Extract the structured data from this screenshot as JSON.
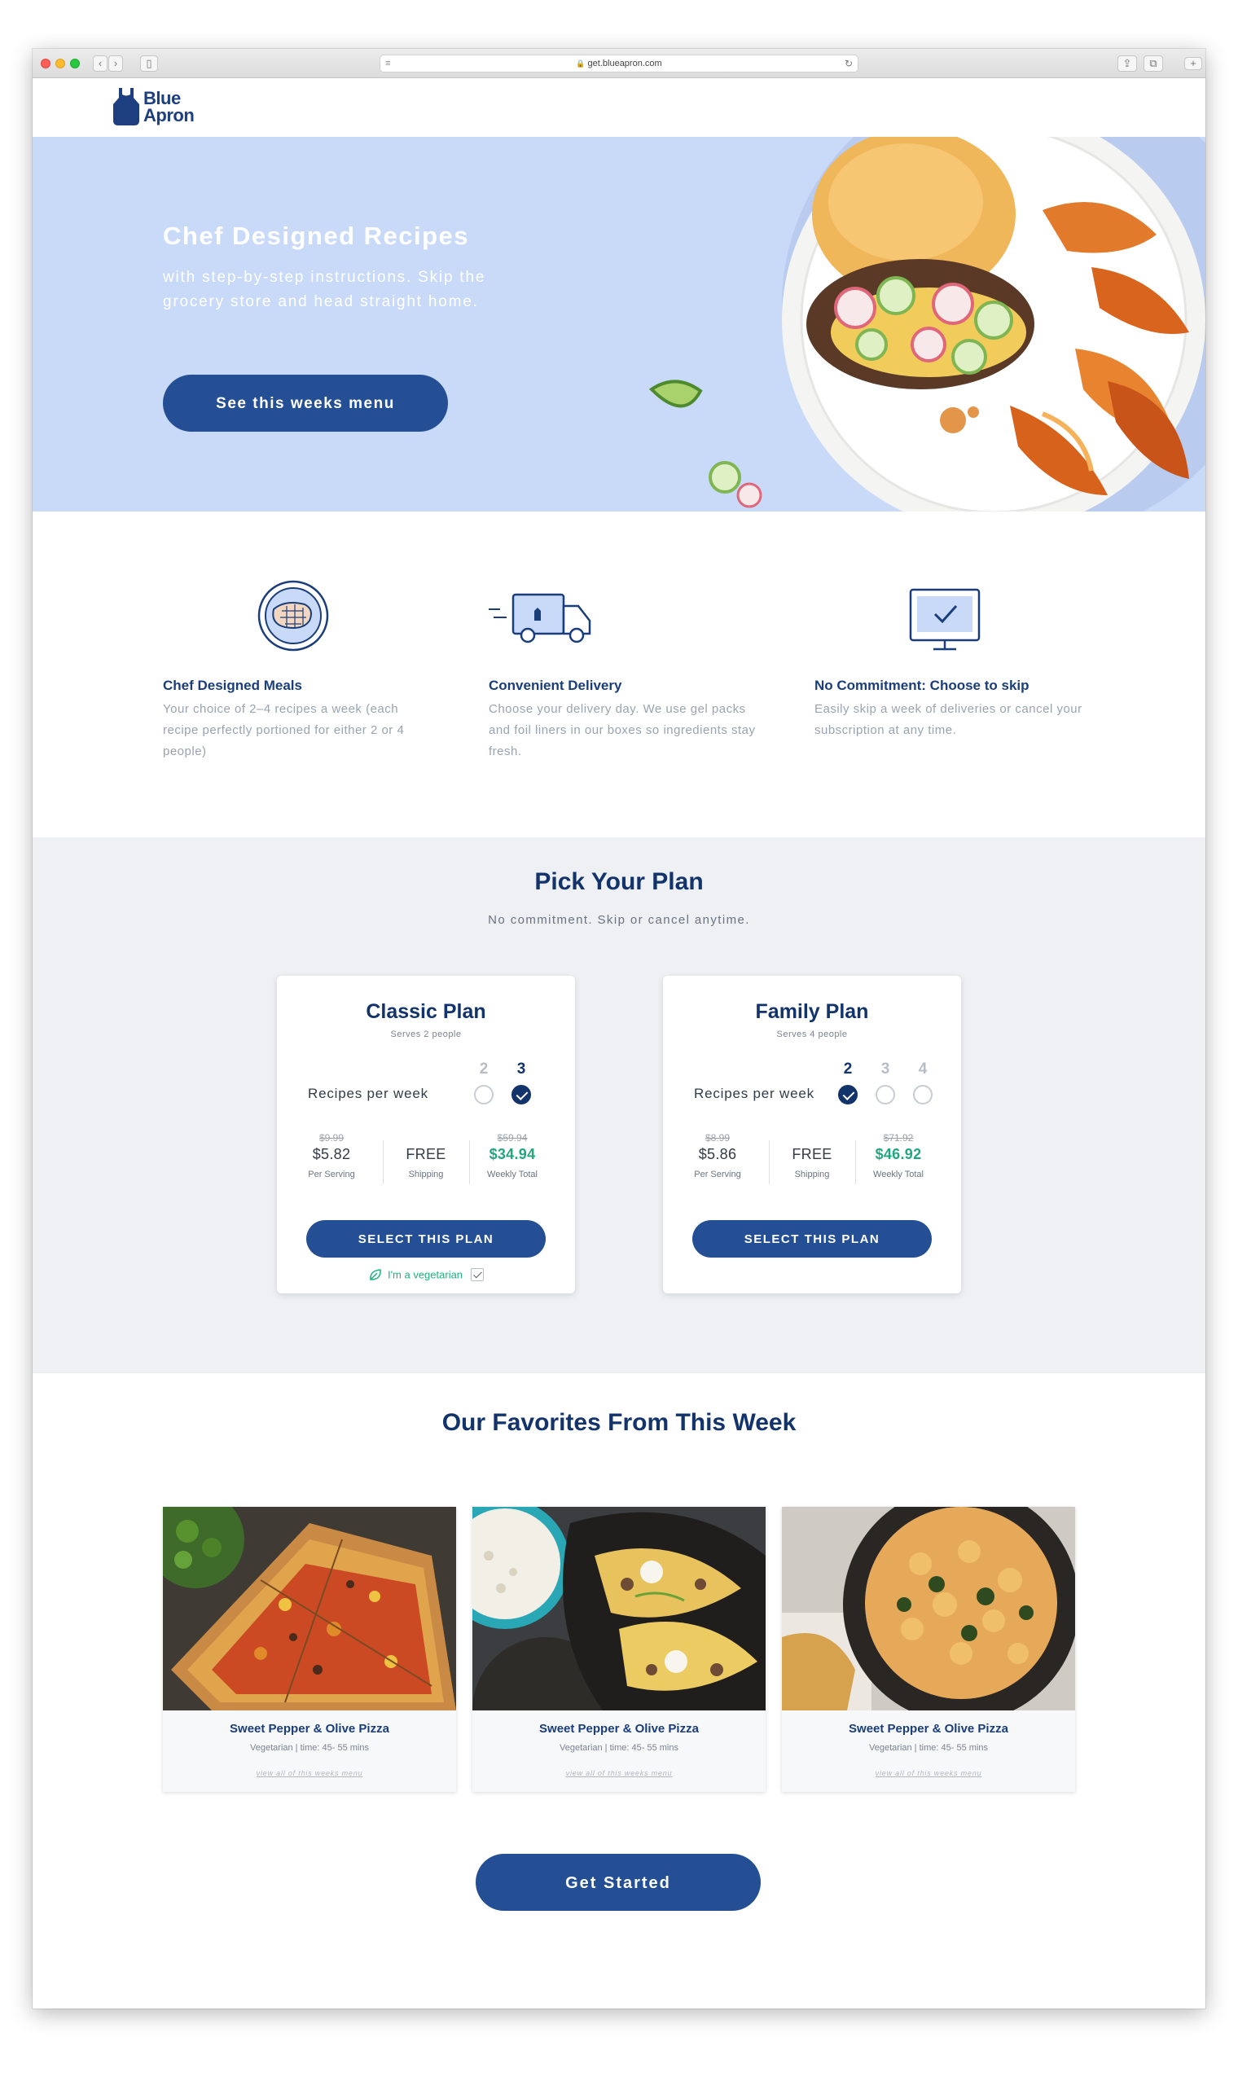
{
  "browser": {
    "url": "get.blueapron.com"
  },
  "header": {
    "logo_line1": "Blue",
    "logo_line2": "Apron"
  },
  "hero": {
    "title": "Chef Designed Recipes",
    "subtitle": "with step-by-step instructions. Skip the grocery store and head straight home.",
    "button_label": "See this weeks menu"
  },
  "features": [
    {
      "icon": "steak-plate-icon",
      "title": "Chef Designed Meals",
      "text": "Your choice of 2–4 recipes a week (each recipe perfectly portioned for either 2 or 4 people)"
    },
    {
      "icon": "delivery-truck-icon",
      "title": "Convenient Delivery",
      "text": "Choose your delivery day. We use gel packs and foil liners in our boxes so ingredients stay fresh."
    },
    {
      "icon": "monitor-check-icon",
      "title": "No Commitment: Choose to skip",
      "text": "Easily skip a week of deliveries or cancel your subscription at any time."
    }
  ],
  "plans_section": {
    "title": "Pick Your Plan",
    "subtitle": "No commitment. Skip or cancel anytime."
  },
  "plans": [
    {
      "name": "Classic Plan",
      "serves": "Serves 2 people",
      "recipes_label": "Recipes per week",
      "options": [
        "2",
        "3"
      ],
      "selected": "3",
      "per_serving_old": "$9.99",
      "per_serving": "$5.82",
      "per_serving_label": "Per Serving",
      "shipping": "FREE",
      "shipping_label": "Shipping",
      "weekly_old": "$59.94",
      "weekly": "$34.94",
      "weekly_label": "Weekly Total",
      "button_label": "SELECT THIS PLAN",
      "vegetarian_label": "I'm a vegetarian",
      "vegetarian_checked": true
    },
    {
      "name": "Family Plan",
      "serves": "Serves 4 people",
      "recipes_label": "Recipes per week",
      "options": [
        "2",
        "3",
        "4"
      ],
      "selected": "2",
      "per_serving_old": "$8.99",
      "per_serving": "$5.86",
      "per_serving_label": "Per Serving",
      "shipping": "FREE",
      "shipping_label": "Shipping",
      "weekly_old": "$71.92",
      "weekly": "$46.92",
      "weekly_label": "Weekly Total",
      "button_label": "SELECT THIS PLAN"
    }
  ],
  "favorites": {
    "title": "Our Favorites From This Week",
    "recipes": [
      {
        "name": "Sweet Pepper & Olive Pizza",
        "meta": "Vegetarian | time: 45- 55 mins",
        "link": "view all of this weeks menu"
      },
      {
        "name": "Sweet Pepper & Olive Pizza",
        "meta": "Vegetarian | time: 45- 55 mins",
        "link": "view all of this weeks menu"
      },
      {
        "name": "Sweet Pepper & Olive Pizza",
        "meta": "Vegetarian | time: 45- 55 mins",
        "link": "view all of this weeks menu"
      }
    ],
    "cta_label": "Get Started"
  },
  "colors": {
    "brand_blue": "#244f94",
    "navy_text": "#12346b",
    "hero_bg": "#c9daf8",
    "section_gray": "#eef0f4",
    "price_green": "#21a77f"
  }
}
